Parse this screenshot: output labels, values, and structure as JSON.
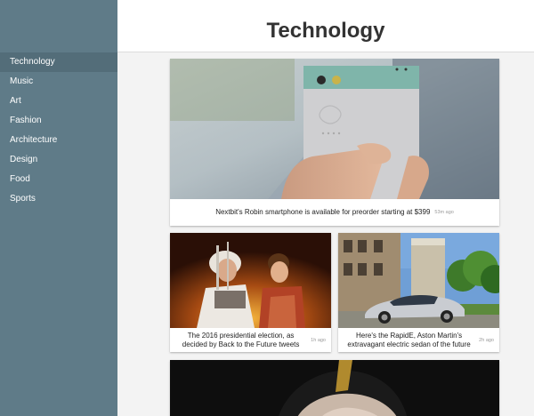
{
  "header": {
    "title": "Technology"
  },
  "sidebar": {
    "items": [
      {
        "label": "Technology",
        "active": true
      },
      {
        "label": "Music"
      },
      {
        "label": "Art"
      },
      {
        "label": "Fashion"
      },
      {
        "label": "Architecture"
      },
      {
        "label": "Design"
      },
      {
        "label": "Food"
      },
      {
        "label": "Sports"
      }
    ]
  },
  "articles": [
    {
      "headline": "Nextbit's Robin smartphone is available for preorder starting at $399",
      "time": "53m ago",
      "image": "phone-in-hand-photo"
    },
    {
      "headline": "The 2016 presidential election, as decided by Back to the Future tweets",
      "time": "1h ago",
      "image": "back-to-the-future-photo"
    },
    {
      "headline": "Here's the RapidE, Aston Martin's extravagant electric sedan of the future",
      "time": "2h ago",
      "image": "aston-martin-car-photo"
    },
    {
      "headline": "",
      "time": "",
      "image": "portrait-photo"
    }
  ],
  "colors": {
    "sidebar": "#5f7b88",
    "sidebar_active": "#536d79",
    "phone_accent": "#7fb5aa"
  }
}
